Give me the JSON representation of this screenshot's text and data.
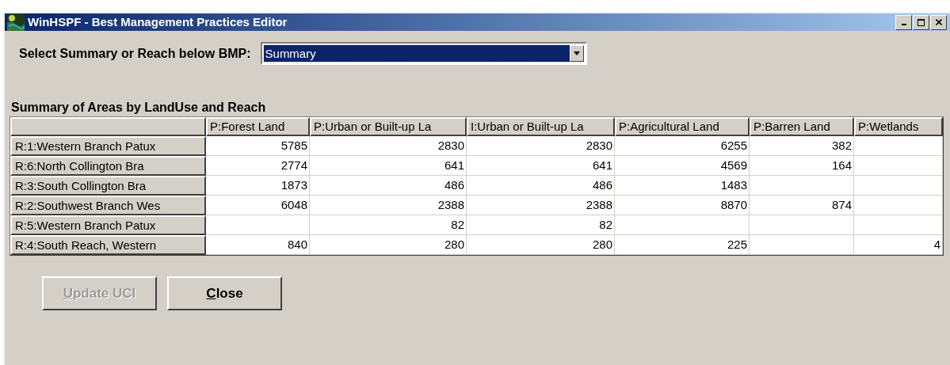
{
  "window": {
    "title": "WinHSPF - Best Management Practices Editor"
  },
  "selector": {
    "label": "Select Summary or Reach below BMP:",
    "value": "Summary"
  },
  "table": {
    "title": "Summary of Areas by LandUse and Reach",
    "columns": [
      "P:Forest Land",
      "P:Urban or Built-up La",
      "I:Urban or Built-up La",
      "P:Agricultural Land",
      "P:Barren Land",
      "P:Wetlands"
    ],
    "rows": [
      {
        "reach": "R:1:Western Branch Patux",
        "cells": [
          "5785",
          "2830",
          "2830",
          "6255",
          "382",
          ""
        ]
      },
      {
        "reach": "R:6:North Collington Bra",
        "cells": [
          "2774",
          "641",
          "641",
          "4569",
          "164",
          ""
        ]
      },
      {
        "reach": "R:3:South Collington Bra",
        "cells": [
          "1873",
          "486",
          "486",
          "1483",
          "",
          ""
        ]
      },
      {
        "reach": "R:2:Southwest Branch Wes",
        "cells": [
          "6048",
          "2388",
          "2388",
          "8870",
          "874",
          ""
        ]
      },
      {
        "reach": "R:5:Western Branch Patux",
        "cells": [
          "",
          "82",
          "82",
          "",
          "",
          ""
        ]
      },
      {
        "reach": "R:4:South Reach, Western",
        "cells": [
          "840",
          "280",
          "280",
          "225",
          "",
          "4"
        ]
      }
    ]
  },
  "buttons": [
    {
      "access_key": "U",
      "label_rest": "pdate UCI",
      "disabled": true
    },
    {
      "access_key": "C",
      "label_rest": "lose",
      "disabled": false
    }
  ]
}
